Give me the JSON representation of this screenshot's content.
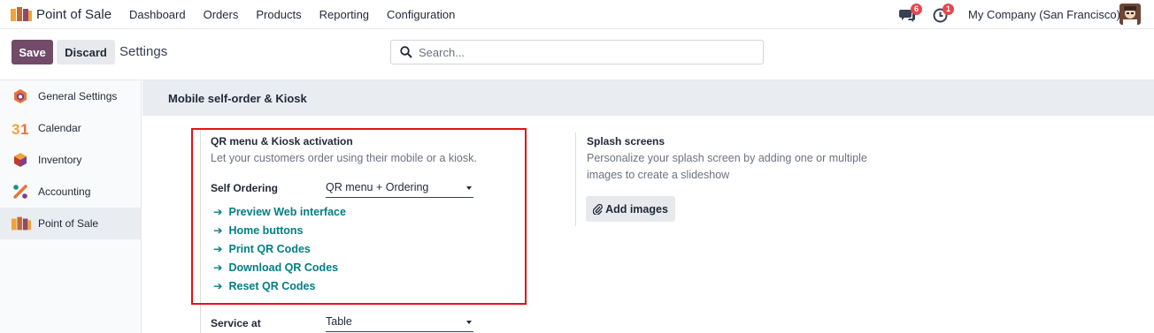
{
  "navbar": {
    "app_title": "Point of Sale",
    "menu": [
      "Dashboard",
      "Orders",
      "Products",
      "Reporting",
      "Configuration"
    ],
    "messages_count": "6",
    "activities_count": "1",
    "company": "My Company (San Francisco)"
  },
  "control_panel": {
    "save_label": "Save",
    "discard_label": "Discard",
    "title": "Settings",
    "search_placeholder": "Search..."
  },
  "sidebar": {
    "items": [
      {
        "label": "General Settings",
        "icon": "general-settings-icon"
      },
      {
        "label": "Calendar",
        "icon": "calendar-icon"
      },
      {
        "label": "Inventory",
        "icon": "inventory-icon"
      },
      {
        "label": "Accounting",
        "icon": "accounting-icon"
      },
      {
        "label": "Point of Sale",
        "icon": "point-of-sale-icon",
        "active": true
      }
    ]
  },
  "section": {
    "title": "Mobile self-order & Kiosk"
  },
  "qr_setting": {
    "title": "QR menu & Kiosk activation",
    "description": "Let your customers order using their mobile or a kiosk.",
    "self_ordering_label": "Self Ordering",
    "self_ordering_value": "QR menu + Ordering",
    "links": [
      "Preview Web interface",
      "Home buttons",
      "Print QR Codes",
      "Download QR Codes",
      "Reset QR Codes"
    ],
    "service_at_label": "Service at",
    "service_at_value": "Table"
  },
  "splash_setting": {
    "title": "Splash screens",
    "description_line1": "Personalize your splash screen by adding one or multiple",
    "description_line2": "images to create a slideshow",
    "add_button": "Add images"
  },
  "colors": {
    "brand": "#714b67",
    "link": "#017e84",
    "highlight_box": "#e3111b",
    "badge": "#e5484d"
  }
}
